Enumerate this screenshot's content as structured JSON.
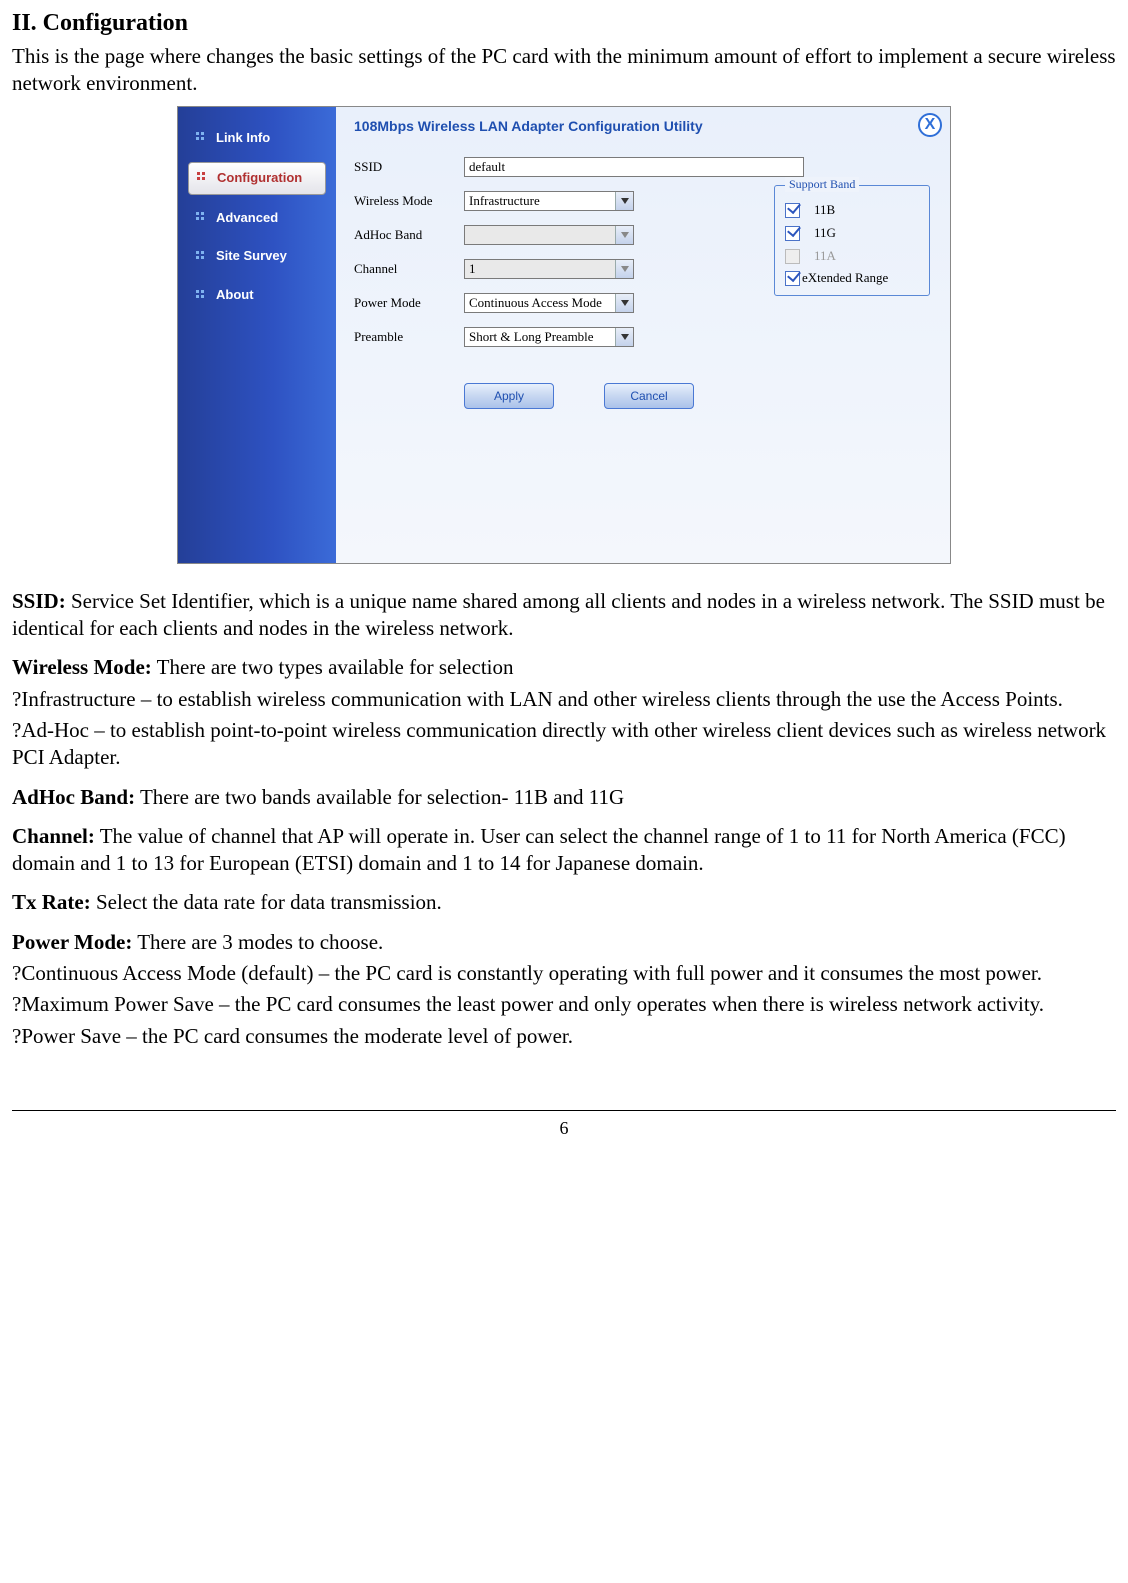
{
  "heading": "II. Configuration",
  "intro": "This is the page where changes the basic settings of the PC card with the minimum amount of effort to implement a secure wireless network environment.",
  "screenshot": {
    "nav": {
      "items": [
        {
          "label": "Link Info",
          "active": false
        },
        {
          "label": "Configuration",
          "active": true
        },
        {
          "label": "Advanced",
          "active": false
        },
        {
          "label": "Site Survey",
          "active": false
        },
        {
          "label": "About",
          "active": false
        }
      ]
    },
    "panel_title": "108Mbps Wireless LAN Adapter Configuration Utility",
    "close": "X",
    "fields": {
      "ssid": {
        "label": "SSID",
        "value": "default"
      },
      "wireless_mode": {
        "label": "Wireless Mode",
        "value": "Infrastructure"
      },
      "adhoc_band": {
        "label": "AdHoc Band",
        "value": ""
      },
      "channel": {
        "label": "Channel",
        "value": "1"
      },
      "power_mode": {
        "label": "Power Mode",
        "value": "Continuous Access Mode"
      },
      "preamble": {
        "label": "Preamble",
        "value": "Short & Long Preamble"
      }
    },
    "support_band": {
      "legend": "Support Band",
      "items": [
        {
          "label": "11B",
          "checked": true,
          "disabled": false
        },
        {
          "label": "11G",
          "checked": true,
          "disabled": false
        },
        {
          "label": "11A",
          "checked": false,
          "disabled": true
        }
      ],
      "extended": {
        "label": "eXtended Range",
        "checked": true
      }
    },
    "buttons": {
      "apply": "Apply",
      "cancel": "Cancel"
    }
  },
  "defs": {
    "ssid": {
      "term": "SSID:",
      "text": " Service Set Identifier, which is a unique name shared among all clients and nodes in a wireless network. The SSID must be identical for each clients and nodes in the wireless network."
    },
    "wireless_mode": {
      "term": "Wireless Mode:",
      "text": " There are two types available for selection",
      "opt1": "?Infrastructure – to establish wireless communication with LAN and other wireless clients through the use the Access Points.",
      "opt2": "?Ad-Hoc – to establish point-to-point wireless communication directly with other wireless client devices such as wireless network PCI Adapter."
    },
    "adhoc_band": {
      "term": "AdHoc Band:",
      "text": " There are two bands available for selection- 11B and 11G"
    },
    "channel": {
      "term": "Channel:",
      "text": " The value of channel that AP will operate in. User can select the channel range of 1 to 11 for North America (FCC) domain and 1 to 13 for European (ETSI) domain and 1 to 14 for Japanese domain."
    },
    "tx_rate": {
      "term": "Tx Rate:",
      "text": " Select the data rate for data transmission."
    },
    "power_mode": {
      "term": "Power Mode:",
      "text": " There are 3 modes to choose.",
      "opt1": "?Continuous Access Mode (default) – the PC card is constantly operating with full power and it consumes the most power.",
      "opt2": "?Maximum Power Save – the PC card consumes the least power and only operates when there is wireless network activity.",
      "opt3": "?Power Save – the PC card consumes the moderate level of power."
    }
  },
  "page_number": "6"
}
